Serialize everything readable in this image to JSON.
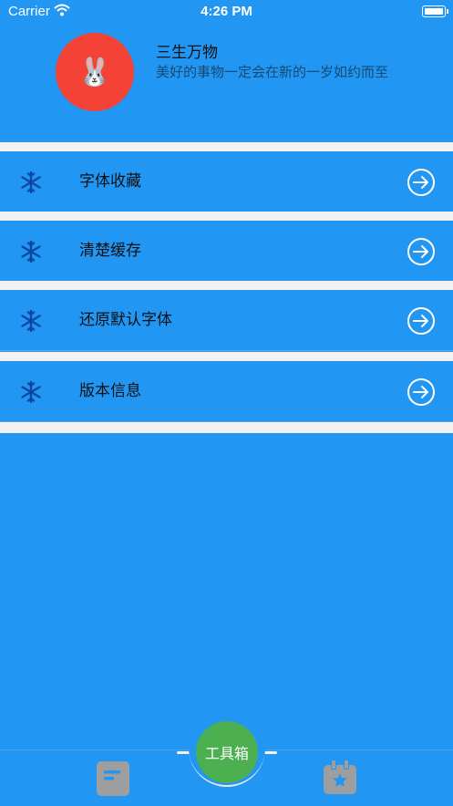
{
  "status_bar": {
    "carrier": "Carrier",
    "time": "4:26 PM"
  },
  "profile": {
    "avatar_emoji": "🐰",
    "name": "三生万物",
    "motto": "美好的事物一定会在新的一岁如约而至"
  },
  "menu": {
    "items": [
      {
        "label": "字体收藏",
        "icon": "snowflake-icon"
      },
      {
        "label": "清楚缓存",
        "icon": "snowflake-icon"
      },
      {
        "label": "还原默认字体",
        "icon": "snowflake-icon"
      },
      {
        "label": "版本信息",
        "icon": "snowflake-icon"
      }
    ],
    "trailing_icon": "arrow-circle-right-icon"
  },
  "tab_bar": {
    "fab_label": "工具箱"
  },
  "colors": {
    "background": "#2196F3",
    "avatar": "#F44336",
    "fab": "#4CAF50",
    "separator": "#F2F2F2",
    "tab_icon": "#9E9E9E"
  }
}
